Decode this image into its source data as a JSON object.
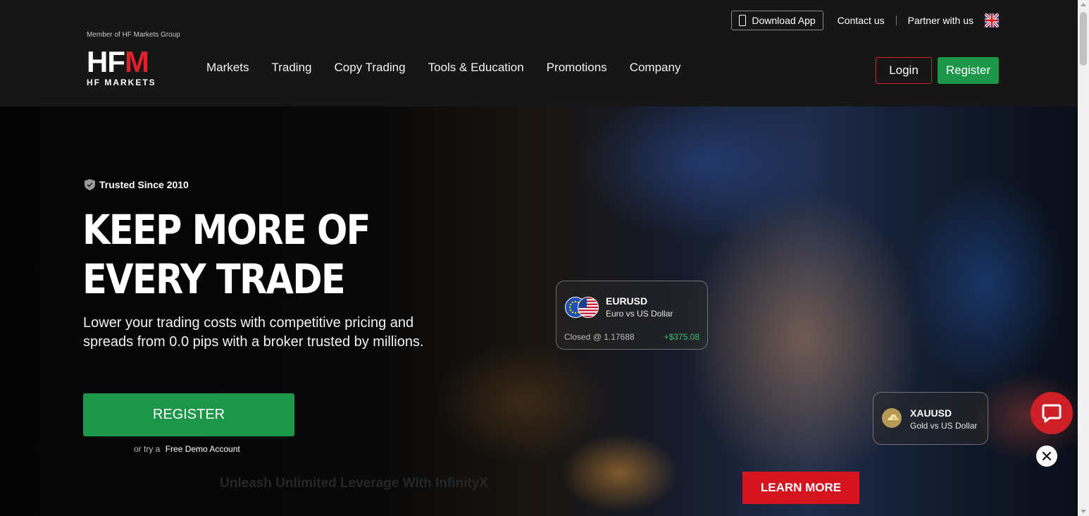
{
  "header": {
    "member_note": "Member of HF Markets Group",
    "logo": {
      "mark_left": "HF",
      "mark_right": "M",
      "subtitle": "HF MARKETS"
    },
    "nav": [
      {
        "label": "Markets"
      },
      {
        "label": "Trading"
      },
      {
        "label": "Copy Trading"
      },
      {
        "label": "Tools & Education"
      },
      {
        "label": "Promotions"
      },
      {
        "label": "Company"
      }
    ],
    "download_app": "Download App",
    "contact": "Contact us",
    "partner": "Partner with us",
    "language_icon": "uk-flag-icon",
    "login": "Login",
    "register": "Register"
  },
  "hero": {
    "trusted": "Trusted Since 2010",
    "headline_line1": "KEEP MORE OF",
    "headline_line2": "EVERY TRADE",
    "subtext": "Lower your trading costs with competitive pricing and spreads from 0.0 pips with a broker trusted by millions.",
    "register_cta": "REGISTER",
    "demo_prefix": "or try a",
    "demo_link": "Free Demo Account",
    "ghost_banner": "Unleash Unlimited Leverage With InfinityX",
    "learn_more": "LEARN MORE"
  },
  "cards": {
    "eurusd": {
      "symbol": "EURUSD",
      "description": "Euro vs US Dollar",
      "closed": "Closed @ 1.17688",
      "pnl": "+$375.08"
    },
    "xauusd": {
      "symbol": "XAUUSD",
      "description": "Gold vs US Dollar"
    }
  },
  "colors": {
    "accent_red": "#d4141e",
    "accent_green": "#1c9648",
    "header_bg": "#161616",
    "pnl_green": "#3fbf6a"
  }
}
